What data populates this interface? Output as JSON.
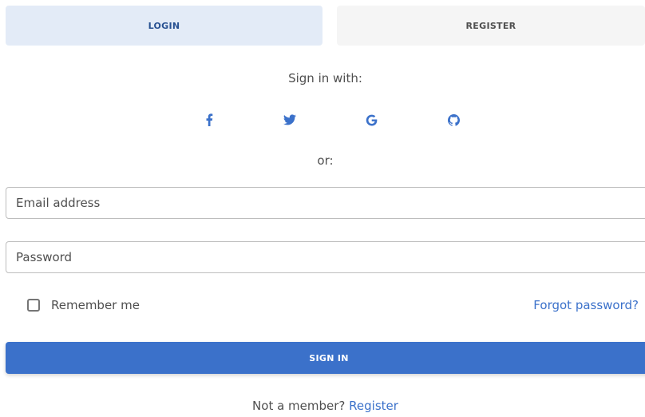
{
  "tabs": {
    "login_label": "LOGIN",
    "register_label": "REGISTER"
  },
  "social": {
    "heading": "Sign in with:",
    "icons": [
      "facebook-icon",
      "twitter-icon",
      "google-icon",
      "github-icon"
    ]
  },
  "separator": "or:",
  "form": {
    "email_placeholder": "Email address",
    "password_placeholder": "Password",
    "remember_label": "Remember me",
    "remember_checked": false,
    "forgot_label": "Forgot password?",
    "submit_label": "SIGN IN"
  },
  "footer": {
    "prompt": "Not a member?",
    "link_label": "Register"
  },
  "colors": {
    "primary": "#3b71ca",
    "active_tab_bg": "#e3ebf7",
    "active_tab_text": "#285192",
    "inactive_tab_bg": "#f5f5f5"
  }
}
